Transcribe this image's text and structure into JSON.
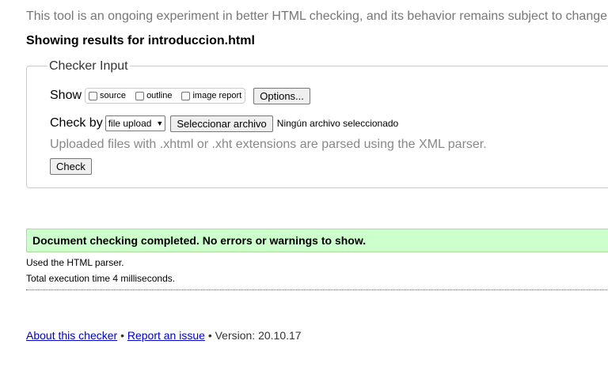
{
  "intro_text": "This tool is an ongoing experiment in better HTML checking, and its behavior remains subject to change",
  "results_heading": "Showing results for introduccion.html",
  "checker": {
    "legend": "Checker Input",
    "show_label": "Show",
    "show_options": [
      "source",
      "outline",
      "image report"
    ],
    "options_button": "Options...",
    "check_by_label": "Check by",
    "check_by_selected": "file upload",
    "file_button": "Seleccionar archivo",
    "file_status": "Ningún archivo seleccionado",
    "note": "Uploaded files with .xhtml or .xht extensions are parsed using the XML parser.",
    "check_button": "Check"
  },
  "result": {
    "success_message": "Document checking completed. No errors or warnings to show.",
    "parser_info": "Used the HTML parser.",
    "execution_time": "Total execution time 4 milliseconds."
  },
  "footer": {
    "about_link": "About this checker",
    "separator": "•",
    "report_link": "Report an issue",
    "version": "Version: 20.10.17"
  },
  "colors": {
    "success_bg": "#ccffcc",
    "link": "#0000cc",
    "muted_text": "#777777"
  }
}
